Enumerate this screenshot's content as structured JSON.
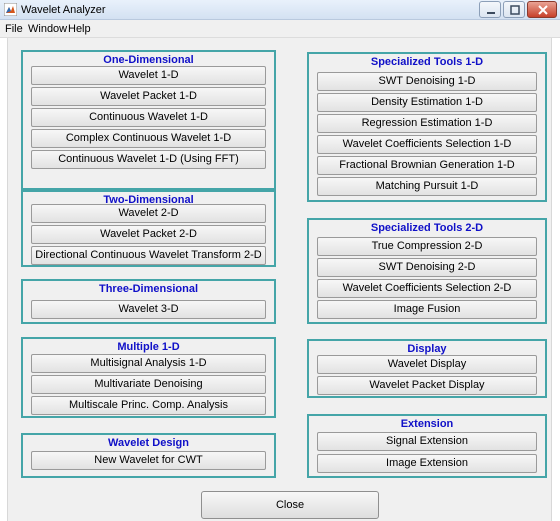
{
  "window": {
    "title": "Wavelet Analyzer"
  },
  "menu": [
    "File",
    "Window",
    "Help"
  ],
  "colors": {
    "panel_border": "#45a5a8",
    "panel_title": "#1010c8",
    "background": "#f0f0f0"
  },
  "panels": {
    "one_d": {
      "title": "One-Dimensional",
      "buttons": [
        "Wavelet 1-D",
        "Wavelet Packet 1-D",
        "Continuous Wavelet 1-D",
        "Complex Continuous Wavelet 1-D",
        "Continuous Wavelet 1-D (Using FFT)"
      ]
    },
    "two_d": {
      "title": "Two-Dimensional",
      "buttons": [
        "Wavelet 2-D",
        "Wavelet Packet 2-D",
        "Directional Continuous  Wavelet Transform 2-D"
      ]
    },
    "three_d": {
      "title": "Three-Dimensional",
      "buttons": [
        "Wavelet 3-D"
      ]
    },
    "multiple": {
      "title": "Multiple 1-D",
      "buttons": [
        "Multisignal Analysis 1-D",
        "Multivariate Denoising",
        "Multiscale Princ. Comp. Analysis"
      ]
    },
    "design": {
      "title": "Wavelet Design",
      "buttons": [
        "New Wavelet for CWT"
      ]
    },
    "spec1": {
      "title": "Specialized Tools 1-D",
      "buttons": [
        "SWT Denoising 1-D",
        "Density Estimation 1-D",
        "Regression Estimation 1-D",
        "Wavelet Coefficients Selection 1-D",
        "Fractional Brownian Generation 1-D",
        "Matching Pursuit 1-D"
      ]
    },
    "spec2": {
      "title": "Specialized Tools 2-D",
      "buttons": [
        "True Compression 2-D",
        "SWT Denoising 2-D",
        "Wavelet Coefficients Selection 2-D",
        "Image Fusion"
      ]
    },
    "display": {
      "title": "Display",
      "buttons": [
        "Wavelet Display",
        "Wavelet Packet Display"
      ]
    },
    "extension": {
      "title": "Extension",
      "buttons": [
        "Signal Extension",
        "Image Extension"
      ]
    }
  },
  "close_label": "Close"
}
